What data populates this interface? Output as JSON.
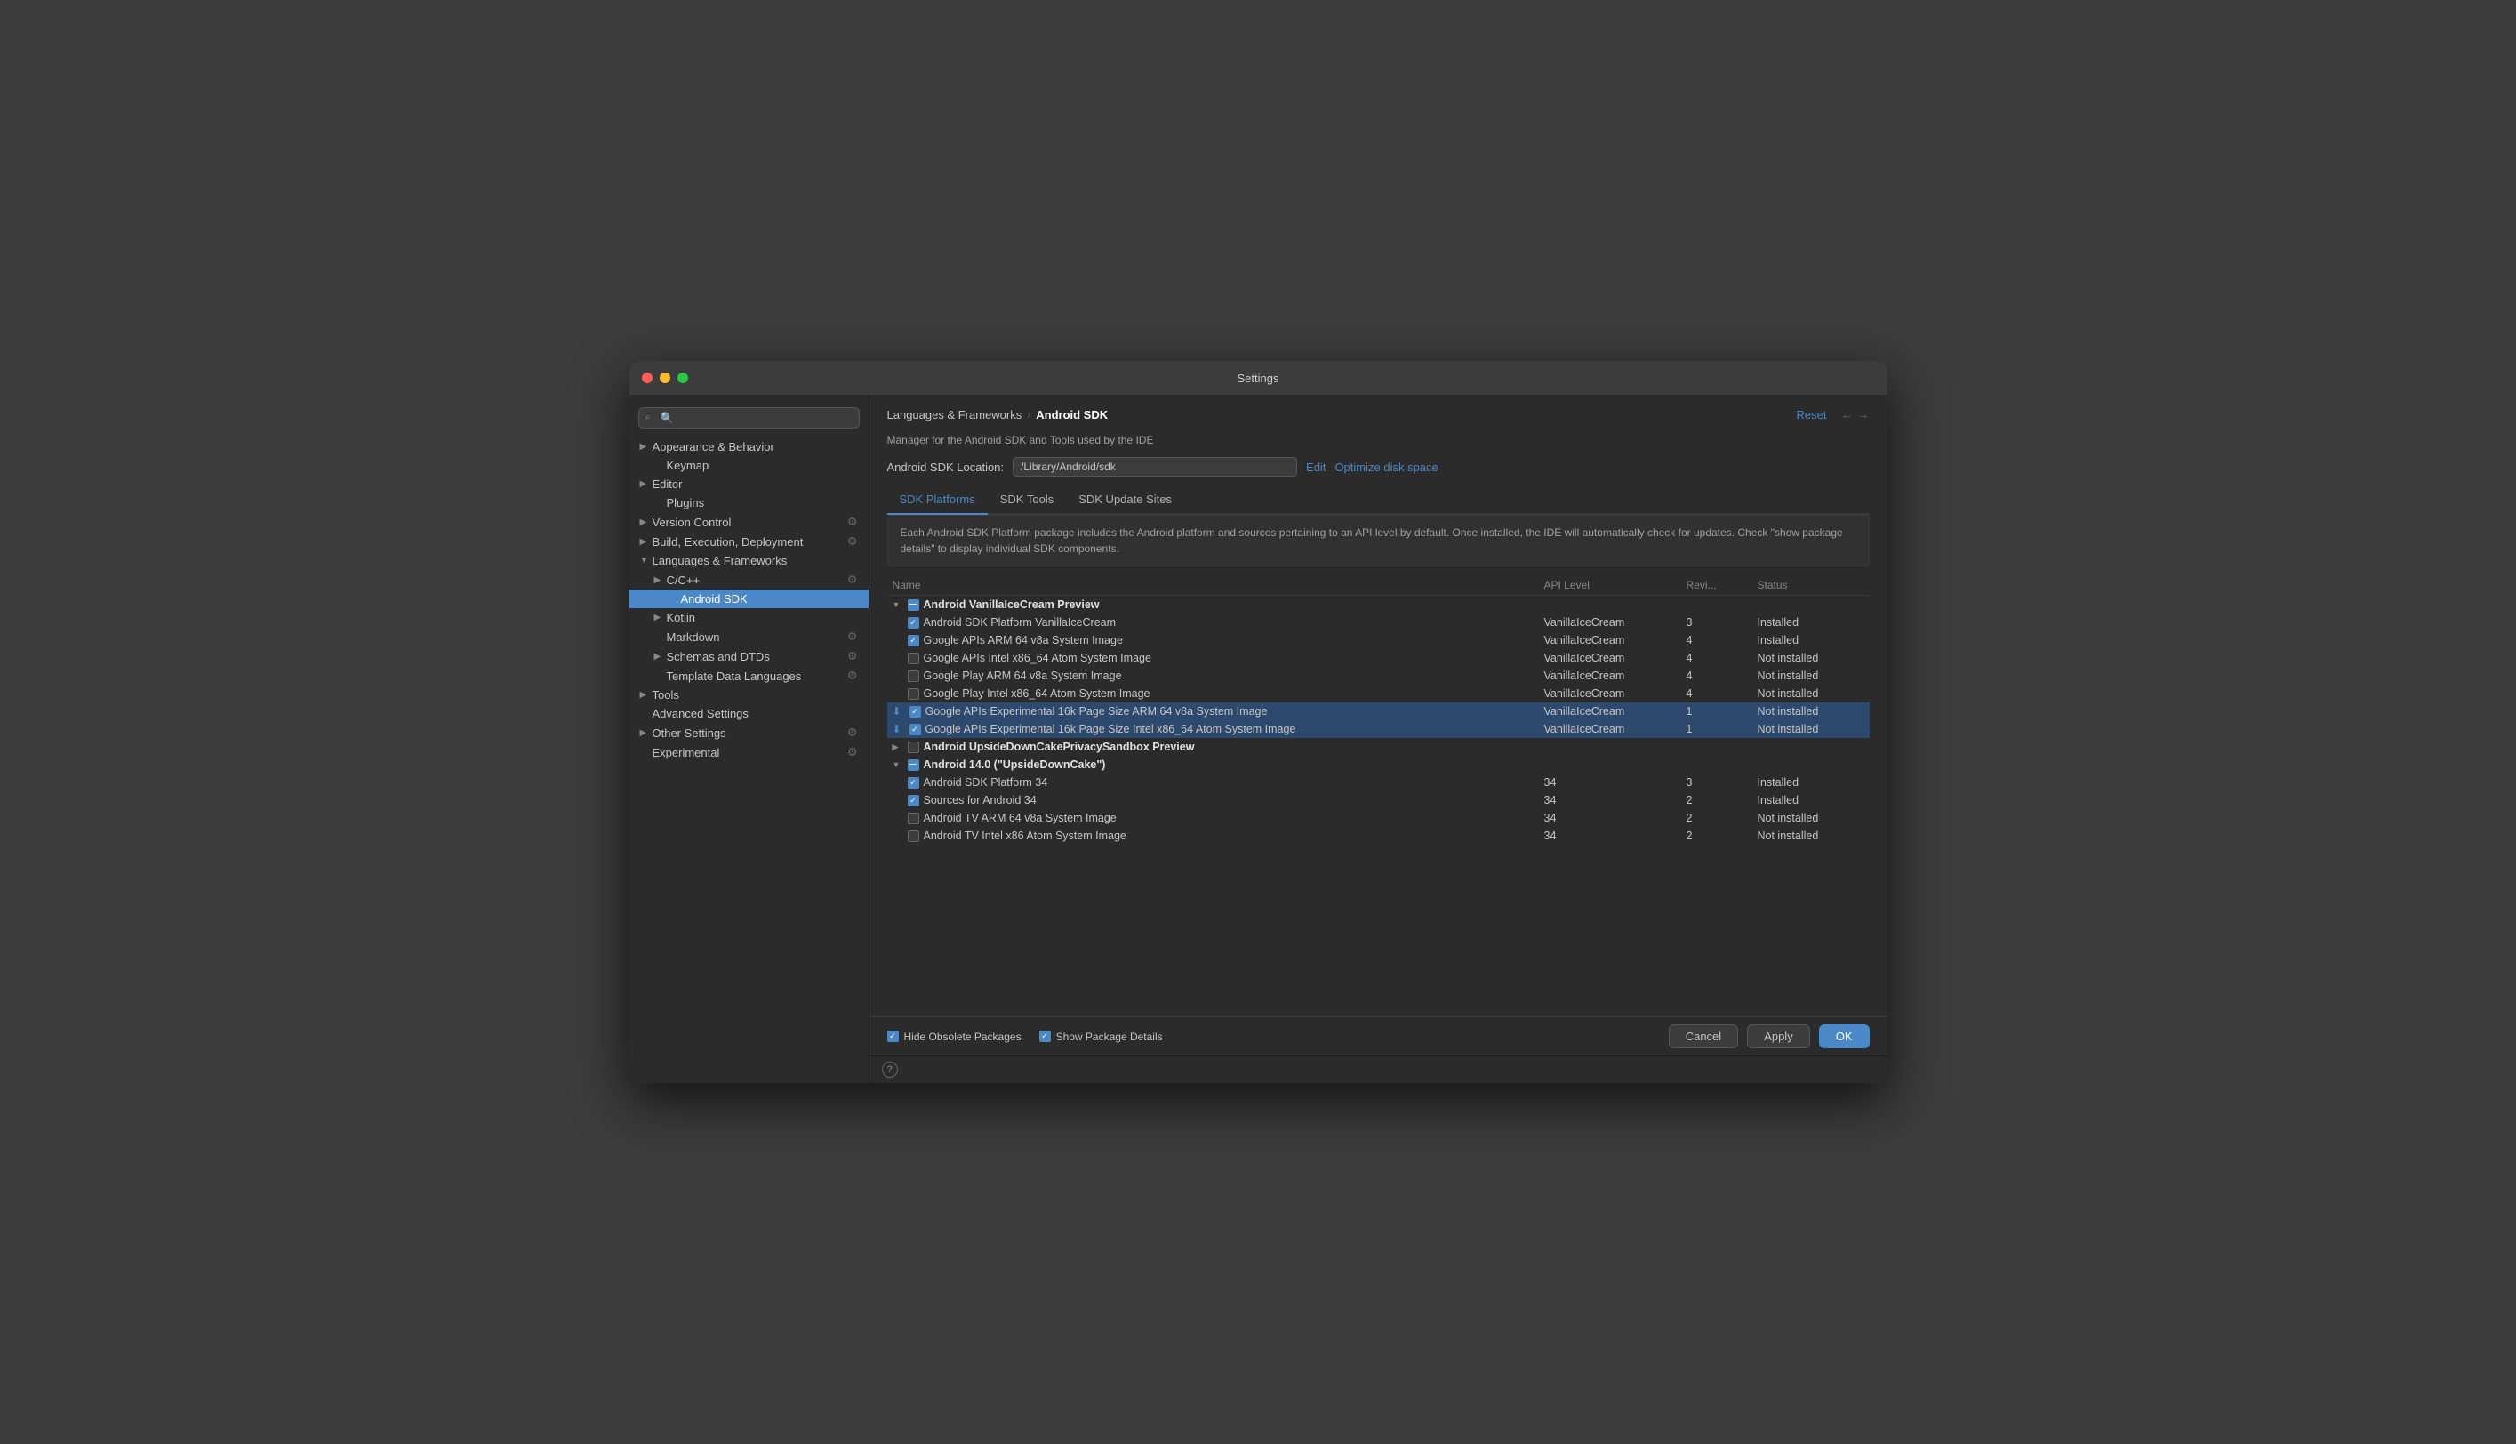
{
  "window": {
    "title": "Settings"
  },
  "sidebar": {
    "search_placeholder": "🔍",
    "items": [
      {
        "id": "appearance",
        "label": "Appearance & Behavior",
        "arrow": "▶",
        "indent": 0,
        "hasIcon": false
      },
      {
        "id": "keymap",
        "label": "Keymap",
        "arrow": "",
        "indent": 1,
        "hasIcon": false
      },
      {
        "id": "editor",
        "label": "Editor",
        "arrow": "▶",
        "indent": 0,
        "hasIcon": false
      },
      {
        "id": "plugins",
        "label": "Plugins",
        "arrow": "",
        "indent": 1,
        "hasIcon": false
      },
      {
        "id": "version-control",
        "label": "Version Control",
        "arrow": "▶",
        "indent": 0,
        "hasIcon": true
      },
      {
        "id": "build-execution",
        "label": "Build, Execution, Deployment",
        "arrow": "▶",
        "indent": 0,
        "hasIcon": true
      },
      {
        "id": "languages",
        "label": "Languages & Frameworks",
        "arrow": "▼",
        "indent": 0,
        "active": false,
        "hasIcon": false
      },
      {
        "id": "cpp",
        "label": "C/C++",
        "arrow": "▶",
        "indent": 1,
        "hasIcon": true
      },
      {
        "id": "android-sdk",
        "label": "Android SDK",
        "arrow": "",
        "indent": 2,
        "active": true,
        "hasIcon": false
      },
      {
        "id": "kotlin",
        "label": "Kotlin",
        "arrow": "▶",
        "indent": 1,
        "hasIcon": false
      },
      {
        "id": "markdown",
        "label": "Markdown",
        "arrow": "",
        "indent": 1,
        "hasIcon": true
      },
      {
        "id": "schemas",
        "label": "Schemas and DTDs",
        "arrow": "▶",
        "indent": 1,
        "hasIcon": true
      },
      {
        "id": "template-data",
        "label": "Template Data Languages",
        "arrow": "",
        "indent": 1,
        "hasIcon": true
      },
      {
        "id": "tools",
        "label": "Tools",
        "arrow": "▶",
        "indent": 0,
        "hasIcon": false
      },
      {
        "id": "advanced",
        "label": "Advanced Settings",
        "arrow": "",
        "indent": 0,
        "hasIcon": false
      },
      {
        "id": "other-settings",
        "label": "Other Settings",
        "arrow": "▶",
        "indent": 0,
        "hasIcon": true
      },
      {
        "id": "experimental",
        "label": "Experimental",
        "arrow": "",
        "indent": 0,
        "hasIcon": true
      }
    ]
  },
  "content": {
    "breadcrumb_parent": "Languages & Frameworks",
    "breadcrumb_child": "Android SDK",
    "reset_label": "Reset",
    "description": "Manager for the Android SDK and Tools used by the IDE",
    "sdk_location_label": "Android SDK Location:",
    "sdk_path": "/Library/Android/sdk",
    "edit_label": "Edit",
    "optimize_label": "Optimize disk space",
    "tabs": [
      {
        "id": "platforms",
        "label": "SDK Platforms",
        "active": true
      },
      {
        "id": "tools",
        "label": "SDK Tools",
        "active": false
      },
      {
        "id": "update-sites",
        "label": "SDK Update Sites",
        "active": false
      }
    ],
    "info_text": "Each Android SDK Platform package includes the Android platform and sources pertaining to an\nAPI level by default. Once installed, the IDE will automatically check for updates. Check \"show\npackage details\" to display individual SDK components.",
    "table": {
      "headers": [
        {
          "id": "name",
          "label": "Name"
        },
        {
          "id": "api",
          "label": "API Level"
        },
        {
          "id": "revision",
          "label": "Revi..."
        },
        {
          "id": "status",
          "label": "Status"
        }
      ],
      "rows": [
        {
          "id": "vanilla-group",
          "type": "section",
          "expand": "▼",
          "checkbox": "mixed",
          "name": "Android VanillaIceCream Preview",
          "api": "",
          "revision": "",
          "status": "",
          "indent": 0
        },
        {
          "id": "vanilla-sdk",
          "type": "item",
          "expand": "",
          "checkbox": "checked",
          "name": "Android SDK Platform VanillaIceCream",
          "api": "VanillaIceCream",
          "revision": "3",
          "status": "Installed",
          "indent": 1
        },
        {
          "id": "vanilla-google-arm",
          "type": "item",
          "expand": "",
          "checkbox": "checked",
          "name": "Google APIs ARM 64 v8a System Image",
          "api": "VanillaIceCream",
          "revision": "4",
          "status": "Installed",
          "indent": 1
        },
        {
          "id": "vanilla-google-intel",
          "type": "item",
          "expand": "",
          "checkbox": "unchecked",
          "name": "Google APIs Intel x86_64 Atom System Image",
          "api": "VanillaIceCream",
          "revision": "4",
          "status": "Not installed",
          "indent": 1
        },
        {
          "id": "vanilla-play-arm",
          "type": "item",
          "expand": "",
          "checkbox": "unchecked",
          "name": "Google Play ARM 64 v8a System Image",
          "api": "VanillaIceCream",
          "revision": "4",
          "status": "Not installed",
          "indent": 1
        },
        {
          "id": "vanilla-play-intel",
          "type": "item",
          "expand": "",
          "checkbox": "unchecked",
          "name": "Google Play Intel x86_64 Atom System Image",
          "api": "VanillaIceCream",
          "revision": "4",
          "status": "Not installed",
          "indent": 1
        },
        {
          "id": "vanilla-exp-arm",
          "type": "item",
          "expand": "",
          "checkbox": "checked",
          "download": true,
          "name": "Google APIs Experimental 16k Page Size ARM 64 v8a System Image",
          "api": "VanillaIceCream",
          "revision": "1",
          "status": "Not installed",
          "indent": 1,
          "highlight": true
        },
        {
          "id": "vanilla-exp-intel",
          "type": "item",
          "expand": "",
          "checkbox": "checked",
          "download": true,
          "name": "Google APIs Experimental 16k Page Size Intel x86_64 Atom System Image",
          "api": "VanillaIceCream",
          "revision": "1",
          "status": "Not installed",
          "indent": 1,
          "highlight": true
        },
        {
          "id": "upsidedown-group",
          "type": "section",
          "expand": "▶",
          "checkbox": "unchecked",
          "name": "Android UpsideDownCakePrivacySandbox Preview",
          "api": "",
          "revision": "",
          "status": "",
          "indent": 0
        },
        {
          "id": "upsidedown14-group",
          "type": "section",
          "expand": "▼",
          "checkbox": "mixed",
          "name": "Android 14.0 (\"UpsideDownCake\")",
          "api": "",
          "revision": "",
          "status": "",
          "indent": 0
        },
        {
          "id": "sdk34",
          "type": "item",
          "expand": "",
          "checkbox": "checked",
          "name": "Android SDK Platform 34",
          "api": "34",
          "revision": "3",
          "status": "Installed",
          "indent": 1
        },
        {
          "id": "sources34",
          "type": "item",
          "expand": "",
          "checkbox": "checked",
          "name": "Sources for Android 34",
          "api": "34",
          "revision": "2",
          "status": "Installed",
          "indent": 1
        },
        {
          "id": "tv-arm-34",
          "type": "item",
          "expand": "",
          "checkbox": "unchecked",
          "name": "Android TV ARM 64 v8a System Image",
          "api": "34",
          "revision": "2",
          "status": "Not installed",
          "indent": 1
        },
        {
          "id": "tv-intel-34",
          "type": "item",
          "expand": "",
          "checkbox": "unchecked",
          "name": "Android TV Intel x86 Atom System Image",
          "api": "34",
          "revision": "2",
          "status": "Not installed",
          "indent": 1
        }
      ]
    },
    "bottom": {
      "hide_obsolete_label": "Hide Obsolete Packages",
      "show_details_label": "Show Package Details",
      "hide_obsolete_checked": true,
      "show_details_checked": true
    },
    "buttons": {
      "cancel": "Cancel",
      "apply": "Apply",
      "ok": "OK"
    }
  }
}
